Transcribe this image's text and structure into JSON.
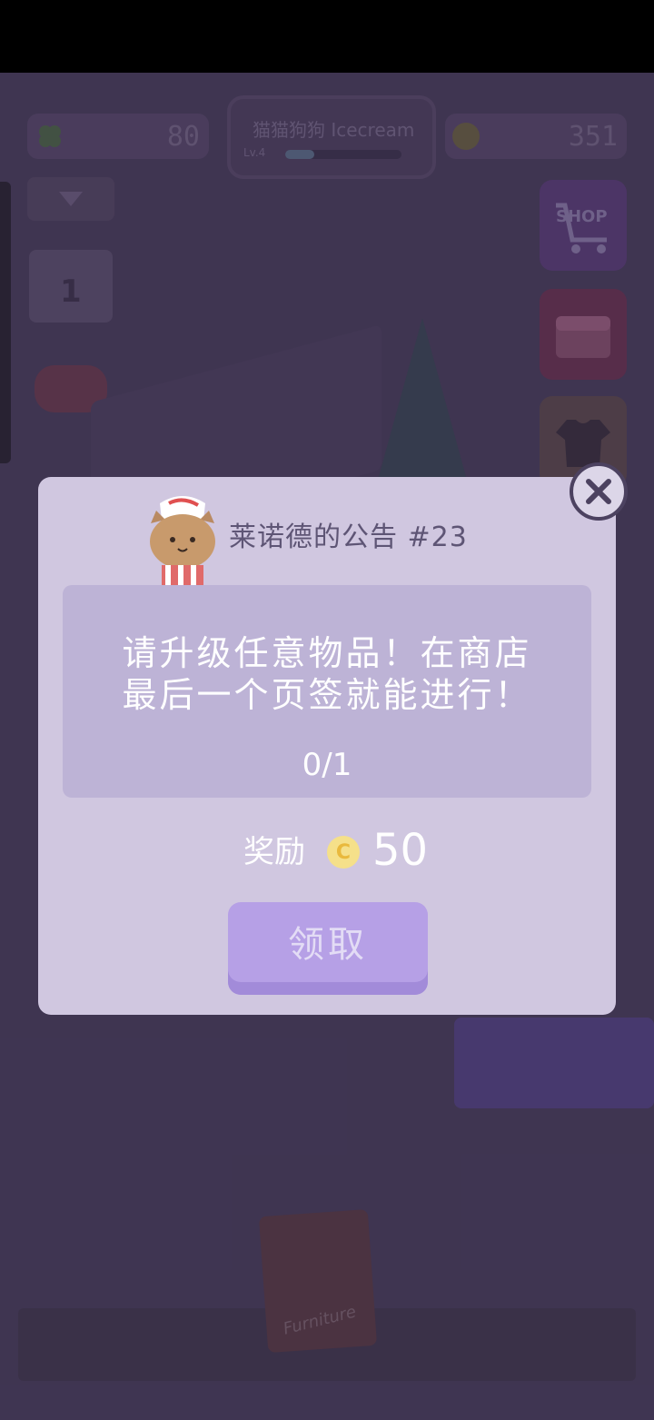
{
  "hud": {
    "clover_count": "80",
    "shop_title": "猫猫狗狗 Icecream",
    "level": "Lv.4",
    "coin_count": "351",
    "shop_button": "SHOP",
    "calendar_day": "1"
  },
  "dialog": {
    "title": "莱诺德的公告 #23",
    "message_line1": "请升级任意物品！在商店",
    "message_line2": "最后一个页签就能进行！",
    "progress": "0/1",
    "reward_label": "奖励",
    "coin_symbol": "C",
    "reward_value": "50",
    "claim_label": "领取"
  },
  "book": {
    "label": "Furniture"
  },
  "colors": {
    "dialog_bg": "#d0c7e0",
    "content_bg": "#bdb3d6",
    "claim_button": "#b6a0e6",
    "coin": "#f5e08a"
  },
  "icons": [
    "close-icon",
    "coin-icon",
    "cat-chef-icon",
    "shop-cart-icon",
    "treasure-chest-icon",
    "shirt-icon",
    "calendar-icon",
    "gamepad-icon",
    "clover-icon",
    "furniture-book-icon"
  ]
}
